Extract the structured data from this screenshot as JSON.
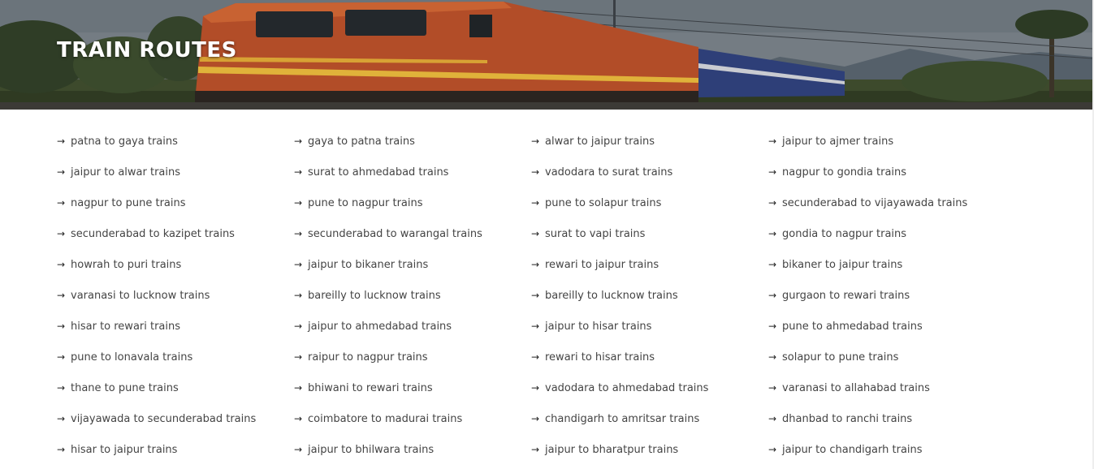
{
  "hero": {
    "title": "TRAIN ROUTES"
  },
  "routes": [
    "patna to gaya trains",
    "gaya to patna trains",
    "alwar to jaipur trains",
    "jaipur to ajmer trains",
    "jaipur to alwar trains",
    "surat to ahmedabad trains",
    "vadodara to surat trains",
    "nagpur to gondia trains",
    "nagpur to pune trains",
    "pune to nagpur trains",
    "pune to solapur trains",
    "secunderabad to vijayawada trains",
    "secunderabad to kazipet trains",
    "secunderabad to warangal trains",
    "surat to vapi trains",
    "gondia to nagpur trains",
    "howrah to puri trains",
    "jaipur to bikaner trains",
    "rewari to jaipur trains",
    "bikaner to jaipur trains",
    "varanasi to lucknow trains",
    "bareilly to lucknow trains",
    "bareilly to lucknow trains",
    "gurgaon to rewari trains",
    "hisar to rewari trains",
    "jaipur to ahmedabad trains",
    "jaipur to hisar trains",
    "pune to ahmedabad trains",
    "pune to lonavala trains",
    "raipur to nagpur trains",
    "rewari to hisar trains",
    "solapur to pune trains",
    "thane to pune trains",
    "bhiwani to rewari trains",
    "vadodara to ahmedabad trains",
    "varanasi to allahabad trains",
    "vijayawada to secunderabad trains",
    "coimbatore to madurai trains",
    "chandigarh to amritsar trains",
    "dhanbad to ranchi trains",
    "hisar to jaipur trains",
    "jaipur to bhilwara trains",
    "jaipur to bharatpur trains",
    "jaipur to chandigarh trains"
  ],
  "icons": {
    "route_arrow": "arrow-right-icon"
  }
}
